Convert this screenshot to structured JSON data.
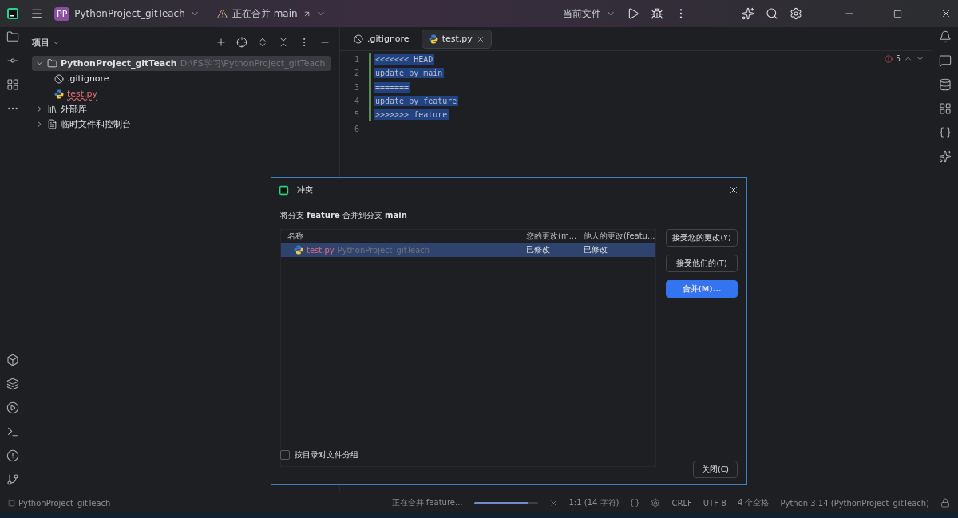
{
  "title_bar": {
    "project_badge": "PP",
    "project": "PythonProject_gitTeach",
    "merge_status": "正在合并 main",
    "run_config": "当前文件"
  },
  "project_panel": {
    "title": "项目",
    "tree": [
      {
        "label": "PythonProject_gitTeach",
        "path": "D:\\FS学习\\PythonProject_gitTeach",
        "kind": "folder",
        "expanded": true,
        "selected": true,
        "children": [
          {
            "label": ".gitignore",
            "kind": "ignore",
            "conflict": false,
            "selected": false
          },
          {
            "label": "test.py",
            "kind": "python",
            "conflict": true,
            "selected": false
          }
        ]
      },
      {
        "label": "外部库",
        "kind": "library",
        "expanded": false,
        "selected": false
      },
      {
        "label": "临时文件和控制台",
        "kind": "scratch",
        "expanded": false,
        "selected": false
      }
    ]
  },
  "editor": {
    "tabs": [
      {
        "label": ".gitignore",
        "kind": "ignore",
        "selected": false
      },
      {
        "label": "test.py",
        "kind": "python",
        "selected": true
      }
    ],
    "error_count": "5",
    "lines": [
      {
        "number": "1",
        "text": "<<<<<<< HEAD",
        "selected": true
      },
      {
        "number": "2",
        "text": "update by main",
        "selected": true
      },
      {
        "number": "3",
        "text": "=======",
        "selected": true
      },
      {
        "number": "4",
        "text": "update by feature",
        "selected": true
      },
      {
        "number": "5",
        "text": ">>>>>>> feature",
        "selected": true
      },
      {
        "number": "6",
        "selected": false
      }
    ]
  },
  "dialog": {
    "title": "冲突",
    "message": "将分支 **feature** 合并到分支 **main**",
    "columns": [
      "名称",
      "您的更改(m...",
      "他人的更改(featu..."
    ],
    "rows": [
      {
        "file": "test.py",
        "project": "PythonProject_gitTeach",
        "yours": "已修改",
        "theirs": "已修改",
        "selected": true
      }
    ],
    "buttons": [
      {
        "label": "接受您的更改(Y)",
        "primary": false
      },
      {
        "label": "接受他们的(T)",
        "primary": false
      },
      {
        "label": "合并(M)...",
        "primary": true
      }
    ],
    "group_checkbox": {
      "label": "按目录对文件分组",
      "checked": false
    },
    "close_label": "关闭(C)"
  },
  "status_bar": {
    "project": "PythonProject_gitTeach",
    "merge_progress": {
      "label": "正在合并 feature...",
      "level": 0.85
    },
    "position": "1:1 (14 字符)",
    "line_ending": "CRLF",
    "encoding": "UTF-8",
    "indent": "4 个空格",
    "interpreter": "Python 3.14 (PythonProject_gitTeach)"
  }
}
